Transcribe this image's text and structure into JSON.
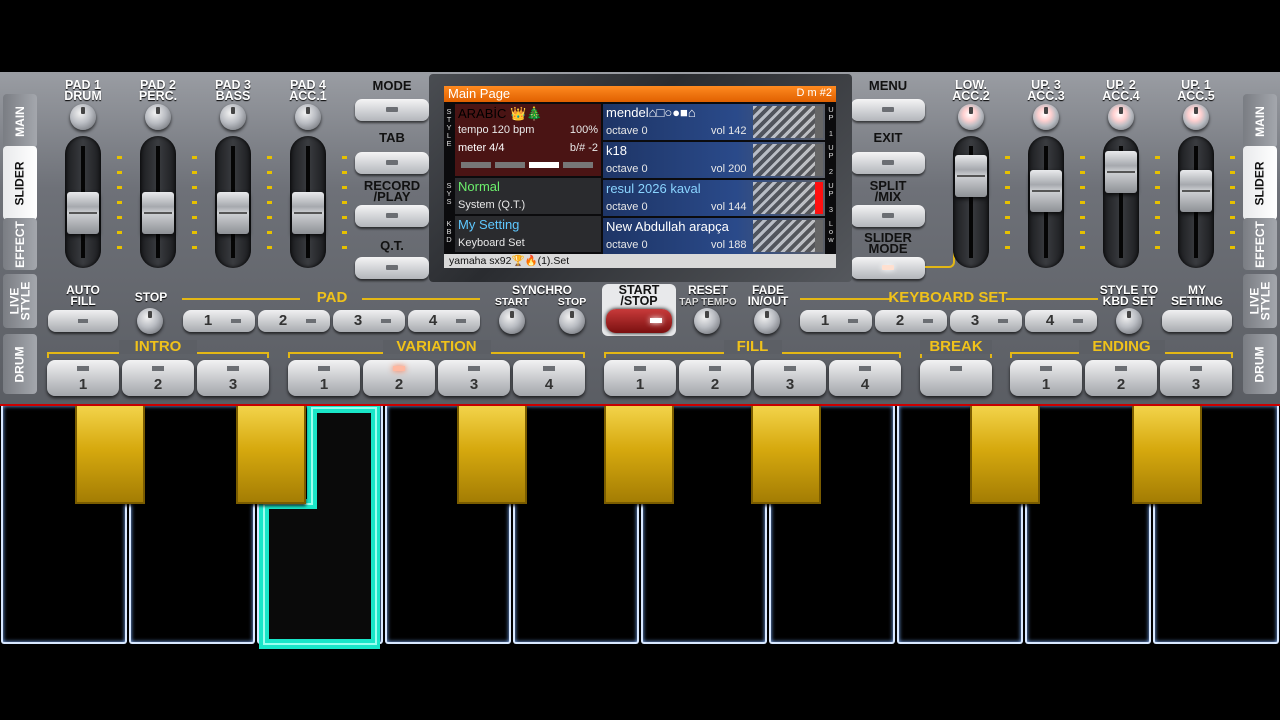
{
  "top_left_pads": [
    {
      "label": "PAD 1\nDRUM"
    },
    {
      "label": "PAD 2\nPERC."
    },
    {
      "label": "PAD 3\nBASS"
    },
    {
      "label": "PAD 4\nACC.1"
    }
  ],
  "top_right_pads": [
    {
      "label": "LOW.\nACC.2"
    },
    {
      "label": "UP. 3\nACC.3"
    },
    {
      "label": "UP. 2\nACC.4"
    },
    {
      "label": "UP. 1\nACC.5"
    }
  ],
  "slider_levels_left": [
    0.35,
    0.35,
    0.35,
    0.35
  ],
  "slider_levels_right": [
    0.85,
    0.65,
    0.9,
    0.65
  ],
  "side_tabs": {
    "main": "MAIN",
    "slider": "SLIDER",
    "effect": "EFFECT",
    "live_style": "LIVE\nSTYLE",
    "drum": "DRUM"
  },
  "left_buttons": {
    "mode": "MODE",
    "tab": "TAB",
    "record_play": "RECORD\n/PLAY",
    "qt": "Q.T."
  },
  "right_buttons": {
    "menu": "MENU",
    "exit": "EXIT",
    "split_mix": "SPLIT\n/MIX",
    "slider_mode": "SLIDER\nMODE"
  },
  "screen": {
    "title": "Main Page",
    "chord": "D m #2",
    "style_name": "ARABİC 👑🎄",
    "tempo": "tempo 120 bpm",
    "tempo_pct": "100%",
    "meter": "meter 4/4",
    "transpose": "b/# -2",
    "sys_name": "Normal",
    "sys_sub": "System (Q.T.)",
    "kbd_name": "My Setting",
    "kbd_sub": "Keyboard Set",
    "voices": [
      {
        "name": "mendel⌂□○●■⌂",
        "octave": "octave  0",
        "vol": "vol 142",
        "side": "UP 1"
      },
      {
        "name": "k18",
        "octave": "octave  0",
        "vol": "vol 200",
        "side": "UP 2"
      },
      {
        "name": "resul 2026 kaval",
        "octave": "octave  0",
        "vol": "vol 144",
        "side": "UP 3"
      },
      {
        "name": "New Abdullah arapça",
        "octave": "octave  0",
        "vol": "vol 188",
        "side": "Low"
      }
    ],
    "style_side": "STYLE",
    "sys_side": "SYS",
    "kbd_side": "KBD",
    "footer": "yamaha sx92🏆🔥(1).Set"
  },
  "row2": {
    "auto_fill": "AUTO\nFILL",
    "stop": "STOP",
    "pad": "PAD",
    "synchro": "SYNCHRO",
    "synchro_start": "START",
    "synchro_stop": "STOP",
    "start_stop": "START\n/STOP",
    "reset": "RESET",
    "tap_tempo": "TAP TEMPO",
    "fade": "FADE\nIN/OUT",
    "keyboard_set": "KEYBOARD SET",
    "style_to_kbd": "STYLE TO\nKBD SET",
    "my_setting": "MY\nSETTING",
    "pad_nums": [
      "1",
      "2",
      "3",
      "4"
    ],
    "kbd_nums": [
      "1",
      "2",
      "3",
      "4"
    ]
  },
  "row3": {
    "intro": "INTRO",
    "variation": "VARIATION",
    "fill": "FILL",
    "break": "BREAK",
    "ending": "ENDING",
    "intro_nums": [
      "1",
      "2",
      "3"
    ],
    "variation_nums": [
      "1",
      "2",
      "3",
      "4"
    ],
    "fill_nums": [
      "1",
      "2",
      "3",
      "4"
    ],
    "ending_nums": [
      "1",
      "2",
      "3"
    ]
  },
  "colors": {
    "accent_gold": "#f0c21a",
    "pressed_key": "#19e6c8",
    "style_name": "#ff7070",
    "sys_name": "#6cf06c",
    "kbd_name": "#5ec8ff"
  }
}
